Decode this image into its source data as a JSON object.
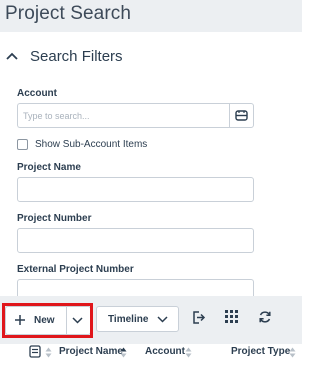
{
  "header": {
    "title": "Project Search"
  },
  "filters": {
    "title": "Search Filters",
    "account_label": "Account",
    "account_placeholder": "Type to search...",
    "sub_account_label": "Show Sub-Account Items",
    "project_name_label": "Project Name",
    "project_number_label": "Project Number",
    "external_project_number_label": "External Project Number"
  },
  "toolbar": {
    "new_label": "New",
    "timeline_label": "Timeline"
  },
  "grid": {
    "columns": [
      "Project Name",
      "Account",
      "Project Type"
    ]
  },
  "colors": {
    "header_bg": "#eceff2",
    "text": "#2c3e50",
    "highlight": "#e0161b"
  }
}
